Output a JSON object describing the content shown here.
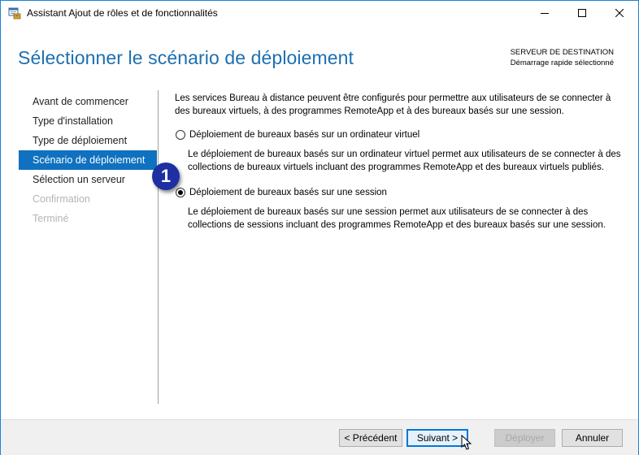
{
  "window": {
    "title": "Assistant Ajout de rôles et de fonctionnalités",
    "controls": [
      "minimize",
      "maximize",
      "close"
    ]
  },
  "header": {
    "title": "Sélectionner le scénario de déploiement",
    "destination_label": "SERVEUR DE DESTINATION",
    "destination_value": "Démarrage rapide sélectionné"
  },
  "nav": {
    "items": [
      {
        "label": "Avant de commencer",
        "state": "normal"
      },
      {
        "label": "Type d'installation",
        "state": "normal"
      },
      {
        "label": "Type de déploiement",
        "state": "normal"
      },
      {
        "label": "Scénario de déploiement",
        "state": "active"
      },
      {
        "label": "Sélection un serveur",
        "state": "normal"
      },
      {
        "label": "Confirmation",
        "state": "disabled"
      },
      {
        "label": "Terminé",
        "state": "disabled"
      }
    ]
  },
  "content": {
    "intro": "Les services Bureau à distance peuvent être configurés pour permettre aux utilisateurs de se connecter à des bureaux virtuels, à des programmes RemoteApp et à des bureaux basés sur une session.",
    "options": [
      {
        "label": "Déploiement de bureaux basés sur un ordinateur virtuel",
        "description": "Le déploiement de bureaux basés sur un ordinateur virtuel permet aux utilisateurs de se connecter à des collections de bureaux virtuels incluant des programmes RemoteApp et des bureaux virtuels publiés.",
        "selected": false
      },
      {
        "label": "Déploiement de bureaux basés sur une session",
        "description": "Le déploiement de bureaux basés sur une session permet aux utilisateurs de se connecter à des collections de sessions incluant des programmes RemoteApp et des bureaux basés sur une session.",
        "selected": true
      }
    ]
  },
  "annotation": {
    "step": "1"
  },
  "footer": {
    "previous": "< Précédent",
    "next": "Suivant >",
    "deploy": "Déployer",
    "cancel": "Annuler"
  },
  "colors": {
    "accent": "#0f71bf",
    "title": "#1d6fb0",
    "badge": "#1d2fa3"
  }
}
